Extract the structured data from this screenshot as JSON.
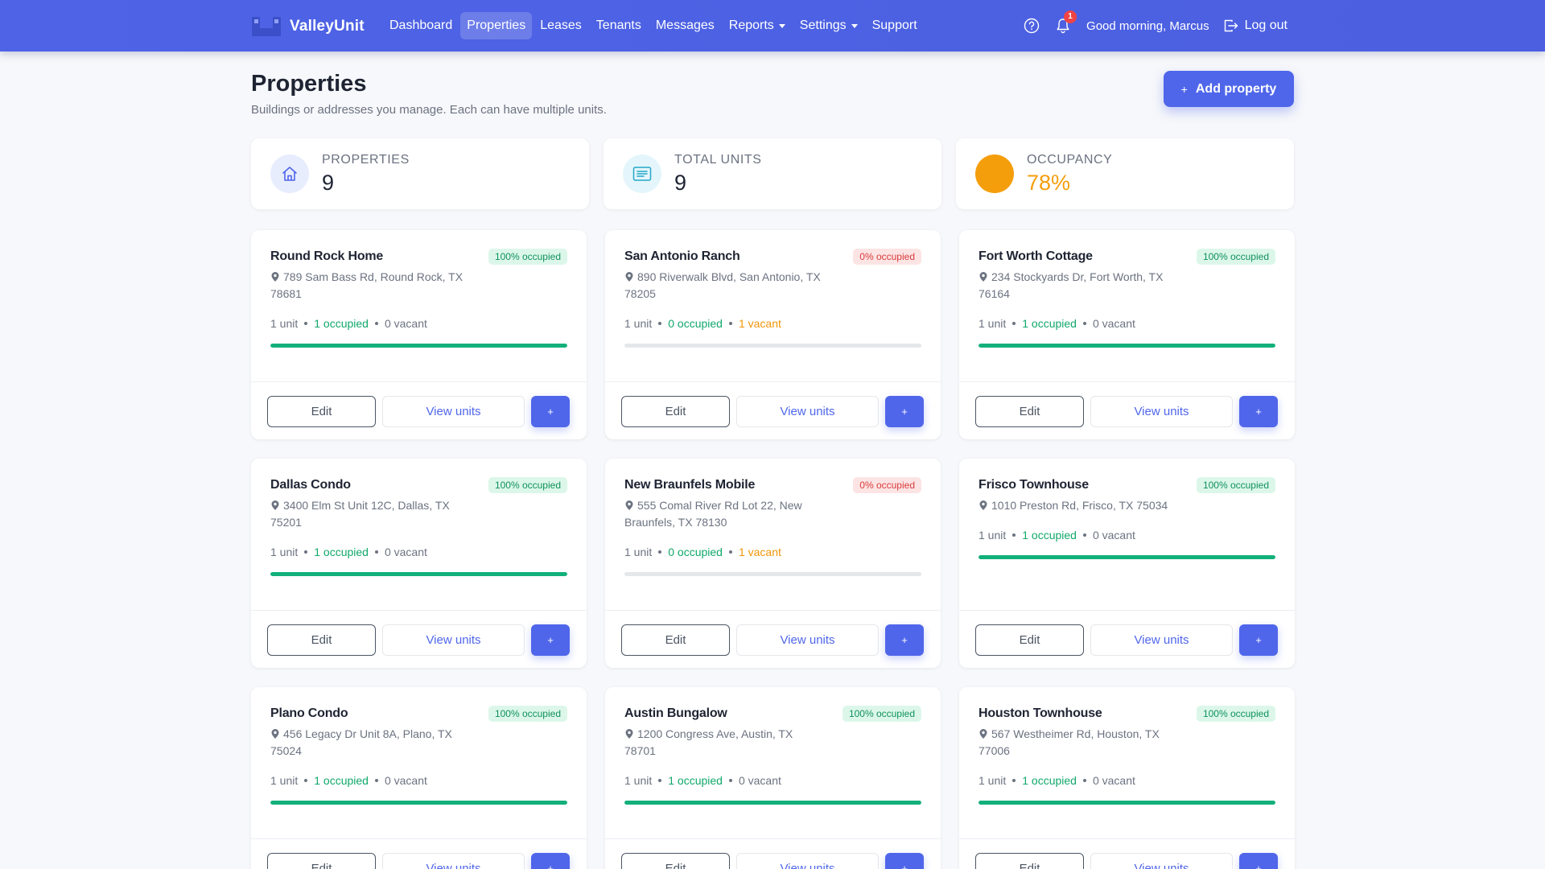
{
  "navbar": {
    "brand": "ValleyUnit",
    "links": [
      {
        "label": "Dashboard",
        "active": false,
        "dropdown": false
      },
      {
        "label": "Properties",
        "active": true,
        "dropdown": false
      },
      {
        "label": "Leases",
        "active": false,
        "dropdown": false
      },
      {
        "label": "Tenants",
        "active": false,
        "dropdown": false
      },
      {
        "label": "Messages",
        "active": false,
        "dropdown": false
      },
      {
        "label": "Reports",
        "active": false,
        "dropdown": true
      },
      {
        "label": "Settings",
        "active": false,
        "dropdown": true
      },
      {
        "label": "Support",
        "active": false,
        "dropdown": false
      }
    ],
    "notification_count": "1",
    "greeting": "Good morning, Marcus",
    "logout_label": "Log out"
  },
  "page": {
    "title": "Properties",
    "subtitle": "Buildings or addresses you manage. Each can have multiple units.",
    "add_button_label": "Add property",
    "add_button_icon": "+"
  },
  "stats": [
    {
      "label": "PROPERTIES",
      "value": "9",
      "icon": "home-icon"
    },
    {
      "label": "TOTAL UNITS",
      "value": "9",
      "icon": "list-icon"
    },
    {
      "label": "OCCUPANCY",
      "value": "78%",
      "icon": "occupancy-circle-icon"
    }
  ],
  "colors": {
    "primary": "#4f66ea",
    "success": "#12b07a",
    "warning": "#f0960a",
    "danger": "#d93b3b",
    "occupancy_accent": "#f59e0b"
  },
  "card_actions": {
    "edit": "Edit",
    "view": "View units",
    "add": "+"
  },
  "properties": [
    {
      "name": "Round Rock Home",
      "badge": "100% occupied",
      "status": "full",
      "address": "789 Sam Bass Rd, Round Rock, TX 78681",
      "units": "1 unit",
      "occupied": "1 occupied",
      "vacant": "0 vacant",
      "occupancy": 1.0
    },
    {
      "name": "San Antonio Ranch",
      "badge": "0% occupied",
      "status": "empty",
      "address": "890 Riverwalk Blvd, San Antonio, TX 78205",
      "units": "1 unit",
      "occupied": "0 occupied",
      "vacant": "1 vacant",
      "occupancy": 0.0
    },
    {
      "name": "Fort Worth Cottage",
      "badge": "100% occupied",
      "status": "full",
      "address": "234 Stockyards Dr, Fort Worth, TX 76164",
      "units": "1 unit",
      "occupied": "1 occupied",
      "vacant": "0 vacant",
      "occupancy": 1.0
    },
    {
      "name": "Dallas Condo",
      "badge": "100% occupied",
      "status": "full",
      "address": "3400 Elm St Unit 12C, Dallas, TX 75201",
      "units": "1 unit",
      "occupied": "1 occupied",
      "vacant": "0 vacant",
      "occupancy": 1.0
    },
    {
      "name": "New Braunfels Mobile",
      "badge": "0% occupied",
      "status": "empty",
      "address": "555 Comal River Rd Lot 22, New Braunfels, TX 78130",
      "units": "1 unit",
      "occupied": "0 occupied",
      "vacant": "1 vacant",
      "occupancy": 0.0
    },
    {
      "name": "Frisco Townhouse",
      "badge": "100% occupied",
      "status": "full",
      "address": "1010 Preston Rd, Frisco, TX 75034",
      "units": "1 unit",
      "occupied": "1 occupied",
      "vacant": "0 vacant",
      "occupancy": 1.0
    },
    {
      "name": "Plano Condo",
      "badge": "100% occupied",
      "status": "full",
      "address": "456 Legacy Dr Unit 8A, Plano, TX 75024",
      "units": "1 unit",
      "occupied": "1 occupied",
      "vacant": "0 vacant",
      "occupancy": 1.0
    },
    {
      "name": "Austin Bungalow",
      "badge": "100% occupied",
      "status": "full",
      "address": "1200 Congress Ave, Austin, TX 78701",
      "units": "1 unit",
      "occupied": "1 occupied",
      "vacant": "0 vacant",
      "occupancy": 1.0
    },
    {
      "name": "Houston Townhouse",
      "badge": "100% occupied",
      "status": "full",
      "address": "567 Westheimer Rd, Houston, TX 77006",
      "units": "1 unit",
      "occupied": "1 occupied",
      "vacant": "0 vacant",
      "occupancy": 1.0
    }
  ]
}
